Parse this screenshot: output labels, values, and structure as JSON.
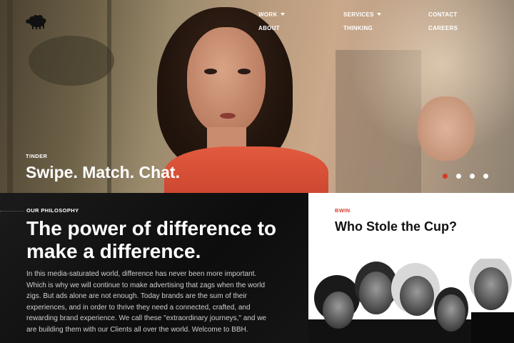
{
  "nav": {
    "items": [
      {
        "label": "WORK",
        "has_dropdown": true
      },
      {
        "label": "SERVICES",
        "has_dropdown": true
      },
      {
        "label": "CONTACT",
        "has_dropdown": false
      },
      {
        "label": "ABOUT",
        "has_dropdown": false
      },
      {
        "label": "THINKING",
        "has_dropdown": false
      },
      {
        "label": "CAREERS",
        "has_dropdown": false
      }
    ]
  },
  "logo": {
    "icon": "black-sheep-icon"
  },
  "hero": {
    "client": "TINDER",
    "title": "Swipe. Match. Chat.",
    "slides_total": 4,
    "active_slide": 1
  },
  "philosophy": {
    "label": "OUR PHILOSOPHY",
    "title": "The power of difference to make a difference.",
    "body": "In this media-saturated world, difference has never been more important. Which is why we will continue to make advertising that zags when the world zigs. But ads alone are not enough. Today brands are the sum of their experiences, and in order to thrive they need a connected, crafted, and rewarding brand experience. We call these \"extraordinary journeys,\" and we are building them with our Clients all over the world. Welcome to BBH."
  },
  "feature": {
    "client": "BWIN",
    "title": "Who Stole the Cup?"
  },
  "colors": {
    "accent": "#d8392b",
    "dark_panel": "#111111",
    "white_panel": "#ffffff"
  }
}
